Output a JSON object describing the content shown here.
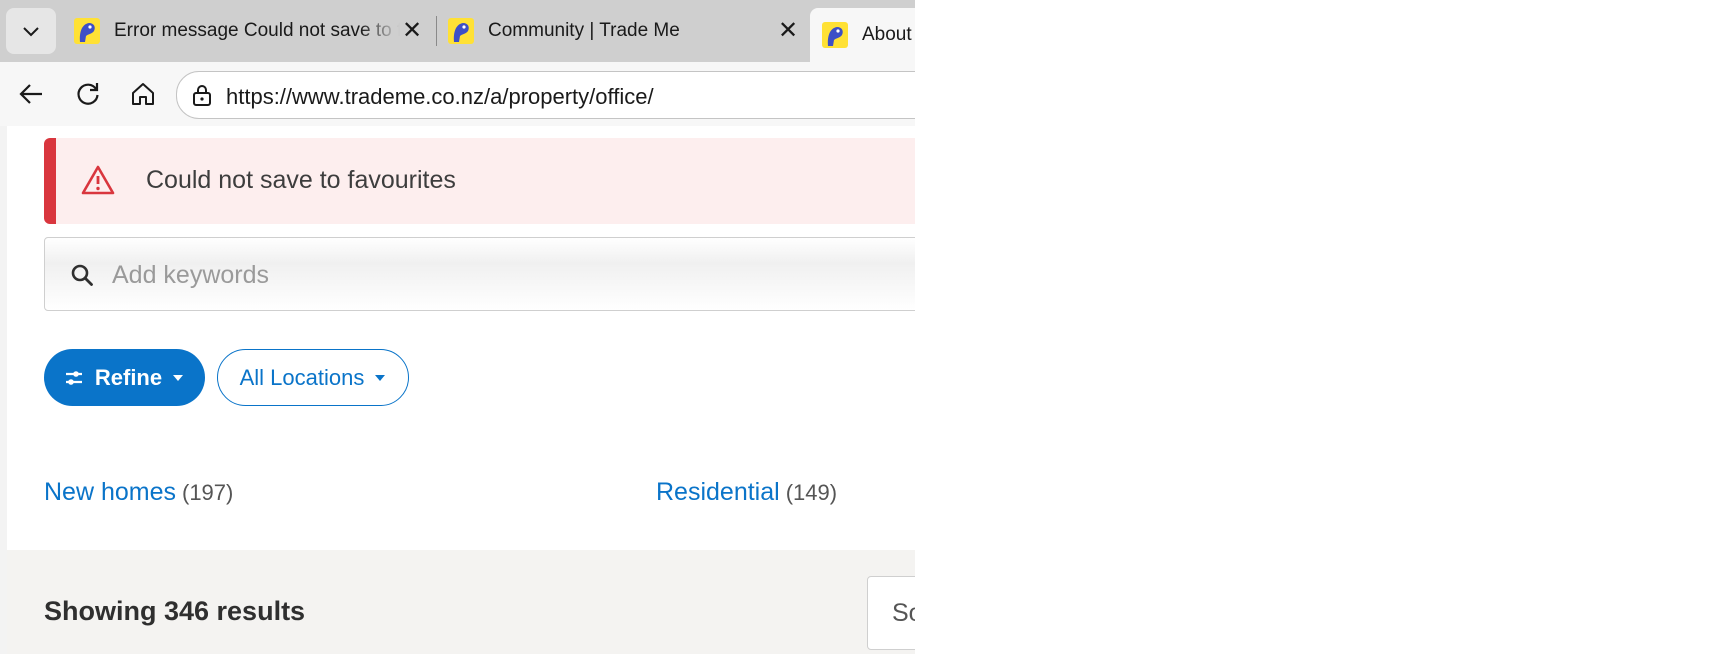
{
  "browser": {
    "tabs": [
      {
        "title": "Error message Could not save to favourites",
        "active": false
      },
      {
        "title": "Community | Trade Me",
        "active": false
      },
      {
        "title": "About",
        "active": true
      }
    ],
    "url": "https://www.trademe.co.nz/a/property/office/"
  },
  "icons": {
    "tab_menu": "chevron-down-icon",
    "favicon": "trademe-kiwi-icon",
    "tab_close": "close-icon",
    "back": "back-arrow-icon",
    "reload": "reload-icon",
    "home": "home-icon",
    "site_info": "lock-icon",
    "warning": "warning-triangle-icon",
    "search": "search-icon",
    "refine": "sliders-icon",
    "dropdown": "caret-down-icon"
  },
  "colors": {
    "brand_blue": "#0a74c9",
    "error_red": "#d9363e",
    "error_bg": "#fdeeee"
  },
  "page": {
    "error_message": "Could not save to favourites",
    "search": {
      "placeholder": "Add keywords",
      "value": ""
    },
    "filters": {
      "refine_label": "Refine",
      "locations_label": "All Locations"
    },
    "categories": [
      {
        "label": "New homes",
        "count": "(197)"
      },
      {
        "label": "Residential",
        "count": "(149)"
      }
    ],
    "results_heading": "Showing 346 results",
    "sort_label": "So"
  }
}
